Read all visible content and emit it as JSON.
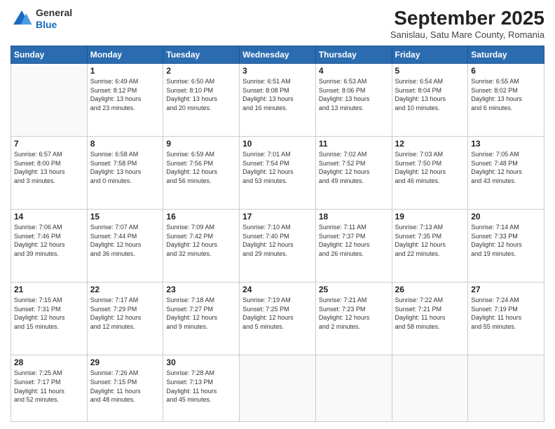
{
  "logo": {
    "general": "General",
    "blue": "Blue"
  },
  "header": {
    "month": "September 2025",
    "location": "Sanislau, Satu Mare County, Romania"
  },
  "weekdays": [
    "Sunday",
    "Monday",
    "Tuesday",
    "Wednesday",
    "Thursday",
    "Friday",
    "Saturday"
  ],
  "weeks": [
    [
      {
        "day": "",
        "info": ""
      },
      {
        "day": "1",
        "info": "Sunrise: 6:49 AM\nSunset: 8:12 PM\nDaylight: 13 hours\nand 23 minutes."
      },
      {
        "day": "2",
        "info": "Sunrise: 6:50 AM\nSunset: 8:10 PM\nDaylight: 13 hours\nand 20 minutes."
      },
      {
        "day": "3",
        "info": "Sunrise: 6:51 AM\nSunset: 8:08 PM\nDaylight: 13 hours\nand 16 minutes."
      },
      {
        "day": "4",
        "info": "Sunrise: 6:53 AM\nSunset: 8:06 PM\nDaylight: 13 hours\nand 13 minutes."
      },
      {
        "day": "5",
        "info": "Sunrise: 6:54 AM\nSunset: 8:04 PM\nDaylight: 13 hours\nand 10 minutes."
      },
      {
        "day": "6",
        "info": "Sunrise: 6:55 AM\nSunset: 8:02 PM\nDaylight: 13 hours\nand 6 minutes."
      }
    ],
    [
      {
        "day": "7",
        "info": "Sunrise: 6:57 AM\nSunset: 8:00 PM\nDaylight: 13 hours\nand 3 minutes."
      },
      {
        "day": "8",
        "info": "Sunrise: 6:58 AM\nSunset: 7:58 PM\nDaylight: 13 hours\nand 0 minutes."
      },
      {
        "day": "9",
        "info": "Sunrise: 6:59 AM\nSunset: 7:56 PM\nDaylight: 12 hours\nand 56 minutes."
      },
      {
        "day": "10",
        "info": "Sunrise: 7:01 AM\nSunset: 7:54 PM\nDaylight: 12 hours\nand 53 minutes."
      },
      {
        "day": "11",
        "info": "Sunrise: 7:02 AM\nSunset: 7:52 PM\nDaylight: 12 hours\nand 49 minutes."
      },
      {
        "day": "12",
        "info": "Sunrise: 7:03 AM\nSunset: 7:50 PM\nDaylight: 12 hours\nand 46 minutes."
      },
      {
        "day": "13",
        "info": "Sunrise: 7:05 AM\nSunset: 7:48 PM\nDaylight: 12 hours\nand 43 minutes."
      }
    ],
    [
      {
        "day": "14",
        "info": "Sunrise: 7:06 AM\nSunset: 7:46 PM\nDaylight: 12 hours\nand 39 minutes."
      },
      {
        "day": "15",
        "info": "Sunrise: 7:07 AM\nSunset: 7:44 PM\nDaylight: 12 hours\nand 36 minutes."
      },
      {
        "day": "16",
        "info": "Sunrise: 7:09 AM\nSunset: 7:42 PM\nDaylight: 12 hours\nand 32 minutes."
      },
      {
        "day": "17",
        "info": "Sunrise: 7:10 AM\nSunset: 7:40 PM\nDaylight: 12 hours\nand 29 minutes."
      },
      {
        "day": "18",
        "info": "Sunrise: 7:11 AM\nSunset: 7:37 PM\nDaylight: 12 hours\nand 26 minutes."
      },
      {
        "day": "19",
        "info": "Sunrise: 7:13 AM\nSunset: 7:35 PM\nDaylight: 12 hours\nand 22 minutes."
      },
      {
        "day": "20",
        "info": "Sunrise: 7:14 AM\nSunset: 7:33 PM\nDaylight: 12 hours\nand 19 minutes."
      }
    ],
    [
      {
        "day": "21",
        "info": "Sunrise: 7:15 AM\nSunset: 7:31 PM\nDaylight: 12 hours\nand 15 minutes."
      },
      {
        "day": "22",
        "info": "Sunrise: 7:17 AM\nSunset: 7:29 PM\nDaylight: 12 hours\nand 12 minutes."
      },
      {
        "day": "23",
        "info": "Sunrise: 7:18 AM\nSunset: 7:27 PM\nDaylight: 12 hours\nand 9 minutes."
      },
      {
        "day": "24",
        "info": "Sunrise: 7:19 AM\nSunset: 7:25 PM\nDaylight: 12 hours\nand 5 minutes."
      },
      {
        "day": "25",
        "info": "Sunrise: 7:21 AM\nSunset: 7:23 PM\nDaylight: 12 hours\nand 2 minutes."
      },
      {
        "day": "26",
        "info": "Sunrise: 7:22 AM\nSunset: 7:21 PM\nDaylight: 11 hours\nand 58 minutes."
      },
      {
        "day": "27",
        "info": "Sunrise: 7:24 AM\nSunset: 7:19 PM\nDaylight: 11 hours\nand 55 minutes."
      }
    ],
    [
      {
        "day": "28",
        "info": "Sunrise: 7:25 AM\nSunset: 7:17 PM\nDaylight: 11 hours\nand 52 minutes."
      },
      {
        "day": "29",
        "info": "Sunrise: 7:26 AM\nSunset: 7:15 PM\nDaylight: 11 hours\nand 48 minutes."
      },
      {
        "day": "30",
        "info": "Sunrise: 7:28 AM\nSunset: 7:13 PM\nDaylight: 11 hours\nand 45 minutes."
      },
      {
        "day": "",
        "info": ""
      },
      {
        "day": "",
        "info": ""
      },
      {
        "day": "",
        "info": ""
      },
      {
        "day": "",
        "info": ""
      }
    ]
  ]
}
